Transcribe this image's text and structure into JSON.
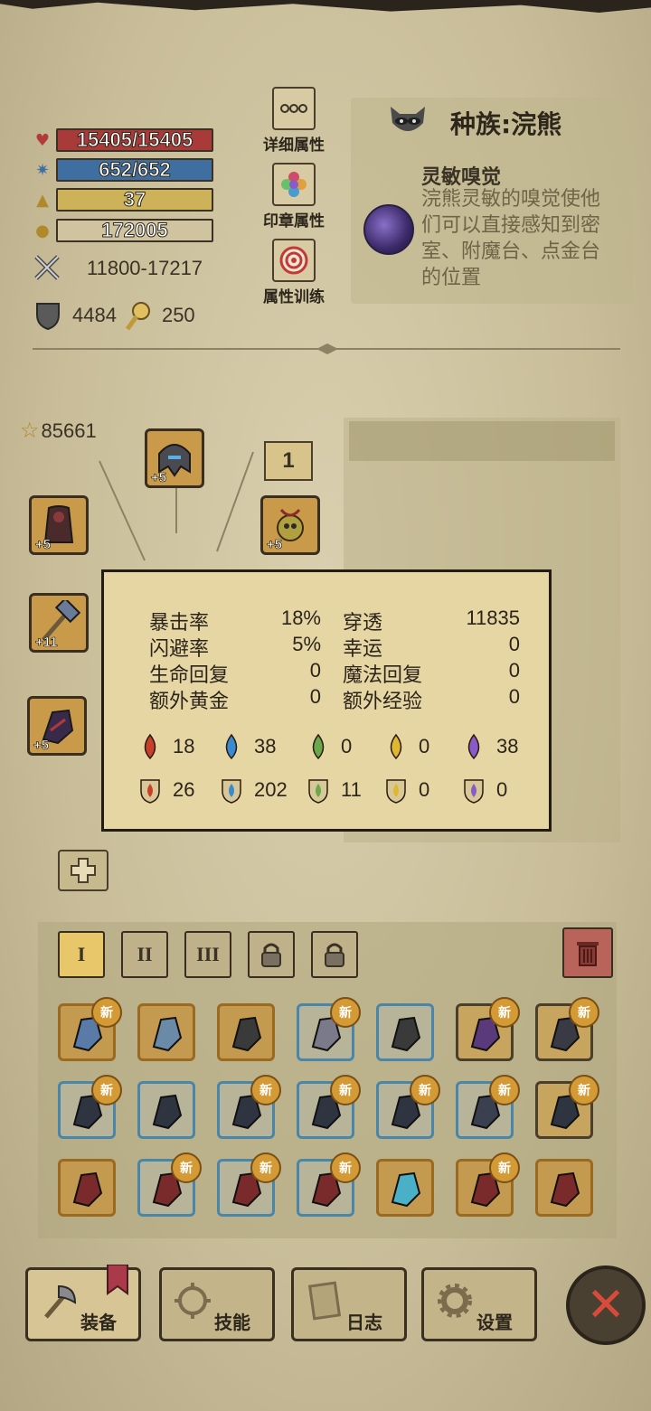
{
  "stats": {
    "hp": "15405/15405",
    "mp": "652/652",
    "level": "37",
    "gold": "172005",
    "attack": "11800-17217",
    "armor": "4484",
    "magic_resist": "250"
  },
  "attr_buttons": [
    "详细属性",
    "印章属性",
    "属性训练"
  ],
  "race": {
    "title": "种族:浣熊",
    "skill_name": "灵敏嗅觉",
    "skill_desc": "浣熊灵敏的嗅觉使他们可以直接感知到密室、附魔台、点金台的位置"
  },
  "power": "85661",
  "level_badge": "1",
  "equip_slots": [
    {
      "name": "helmet",
      "plus": "+5"
    },
    {
      "name": "cape",
      "plus": "+5"
    },
    {
      "name": "amulet",
      "plus": "+5"
    },
    {
      "name": "weapon",
      "plus": "+11"
    },
    {
      "name": "offhand",
      "plus": "+5"
    }
  ],
  "tooltip": {
    "rows": [
      {
        "label": "暴击率",
        "value": "18%",
        "label2": "穿透",
        "value2": "11835"
      },
      {
        "label": "闪避率",
        "value": "5%",
        "label2": "幸运",
        "value2": "0"
      },
      {
        "label": "生命回复",
        "value": "0",
        "label2": "魔法回复",
        "value2": "0"
      },
      {
        "label": "额外黄金",
        "value": "0",
        "label2": "额外经验",
        "value2": "0"
      }
    ],
    "elements_attack": [
      "18",
      "38",
      "0",
      "0",
      "38"
    ],
    "elements_resist": [
      "26",
      "202",
      "11",
      "0",
      "0"
    ]
  },
  "inventory": {
    "tabs": [
      "I",
      "II",
      "III"
    ],
    "new_label": "新",
    "items": [
      {
        "kind": "sword",
        "frame": "gold",
        "new": true
      },
      {
        "kind": "hammer",
        "frame": "gold",
        "new": false
      },
      {
        "kind": "mace",
        "frame": "gold",
        "new": false
      },
      {
        "kind": "blade",
        "frame": "blue",
        "new": true
      },
      {
        "kind": "mace",
        "frame": "blue",
        "new": false
      },
      {
        "kind": "helm",
        "frame": "plain",
        "new": true
      },
      {
        "kind": "chest",
        "frame": "plain",
        "new": true
      },
      {
        "kind": "armor",
        "frame": "blue",
        "new": true
      },
      {
        "kind": "armor",
        "frame": "blue",
        "new": false
      },
      {
        "kind": "armor",
        "frame": "blue",
        "new": true
      },
      {
        "kind": "armor",
        "frame": "blue",
        "new": true
      },
      {
        "kind": "armor",
        "frame": "blue",
        "new": true
      },
      {
        "kind": "pants",
        "frame": "blue",
        "new": true
      },
      {
        "kind": "armor",
        "frame": "plain",
        "new": true
      },
      {
        "kind": "boots",
        "frame": "gold",
        "new": false
      },
      {
        "kind": "boots",
        "frame": "blue",
        "new": true
      },
      {
        "kind": "boots",
        "frame": "blue",
        "new": true
      },
      {
        "kind": "boots",
        "frame": "blue",
        "new": true
      },
      {
        "kind": "ring",
        "frame": "gold",
        "new": false
      },
      {
        "kind": "gauntlet",
        "frame": "gold",
        "new": true
      },
      {
        "kind": "gauntlet",
        "frame": "gold",
        "new": false
      }
    ]
  },
  "nav": [
    "装备",
    "技能",
    "日志",
    "设置"
  ],
  "colors": {
    "hp": "#a83a3a",
    "mp": "#3f6fa0",
    "level": "#cdb25a",
    "gold": "#cfc3a0"
  }
}
